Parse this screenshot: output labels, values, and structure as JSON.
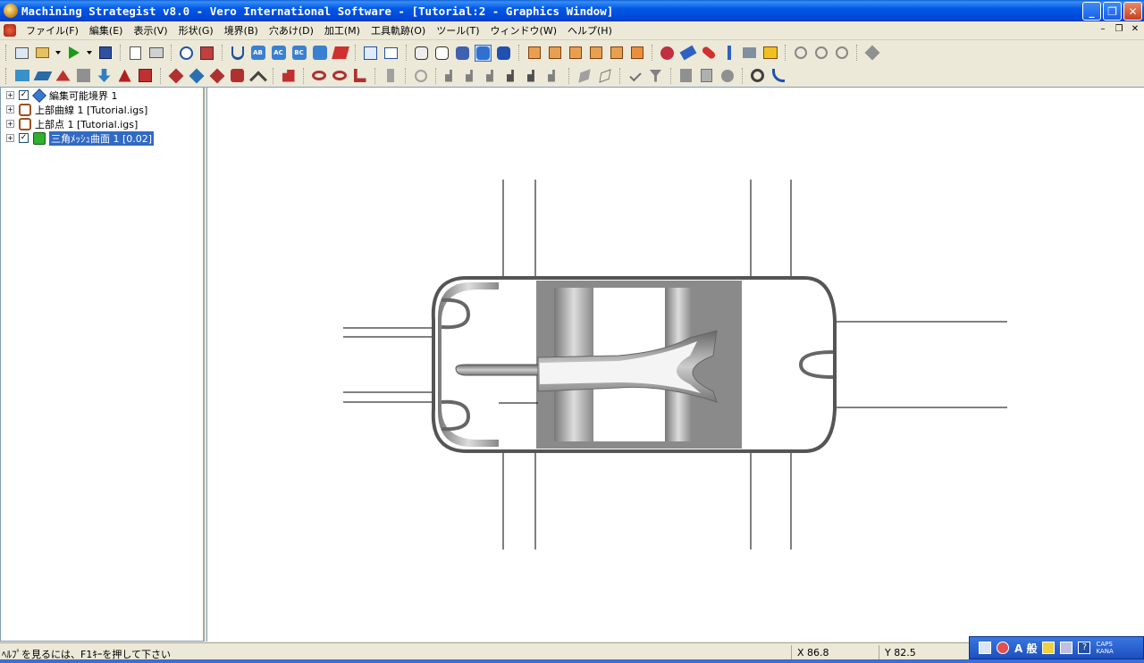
{
  "window": {
    "title": "Machining Strategist v8.0 - Vero International Software - [Tutorial:2 - Graphics Window]",
    "minimize": "_",
    "restore": "❐",
    "close": "✕"
  },
  "menu": {
    "items": [
      "ファイル(F)",
      "編集(E)",
      "表示(V)",
      "形状(G)",
      "境界(B)",
      "穴あけ(D)",
      "加工(M)",
      "工具軌跡(O)",
      "ツール(T)",
      "ウィンドウ(W)",
      "ヘルプ(H)"
    ],
    "mdi_minimize": "–",
    "mdi_restore": "❐",
    "mdi_close": "✕"
  },
  "toolbar1": {
    "text_icons": [
      "AB",
      "AC",
      "BC"
    ]
  },
  "tree": {
    "items": [
      {
        "label": "編集可能境界 1",
        "checked": true,
        "expander": "+",
        "check_mark": "✓"
      },
      {
        "label": "上部曲線 1 [Tutorial.igs]",
        "checked": false,
        "expander": "+"
      },
      {
        "label": "上部点 1 [Tutorial.igs]",
        "checked": false,
        "expander": "+"
      },
      {
        "label": "三角ﾒｯｼｭ曲面 1 [0.02]",
        "checked": true,
        "expander": "+",
        "check_mark": "✓",
        "selected": true
      }
    ]
  },
  "status": {
    "message": "ﾍﾙﾌﾟを見るには、F1ｷｰを押して下さい",
    "x": "X 86.8",
    "y": "Y 82.5"
  },
  "ime": {
    "mode": "A 般",
    "caps": "CAPS",
    "kana": "KANA",
    "help": "?"
  },
  "colors": {
    "title_bar": "#0054e3",
    "selection": "#316ac5",
    "part_gray": "#888888"
  }
}
